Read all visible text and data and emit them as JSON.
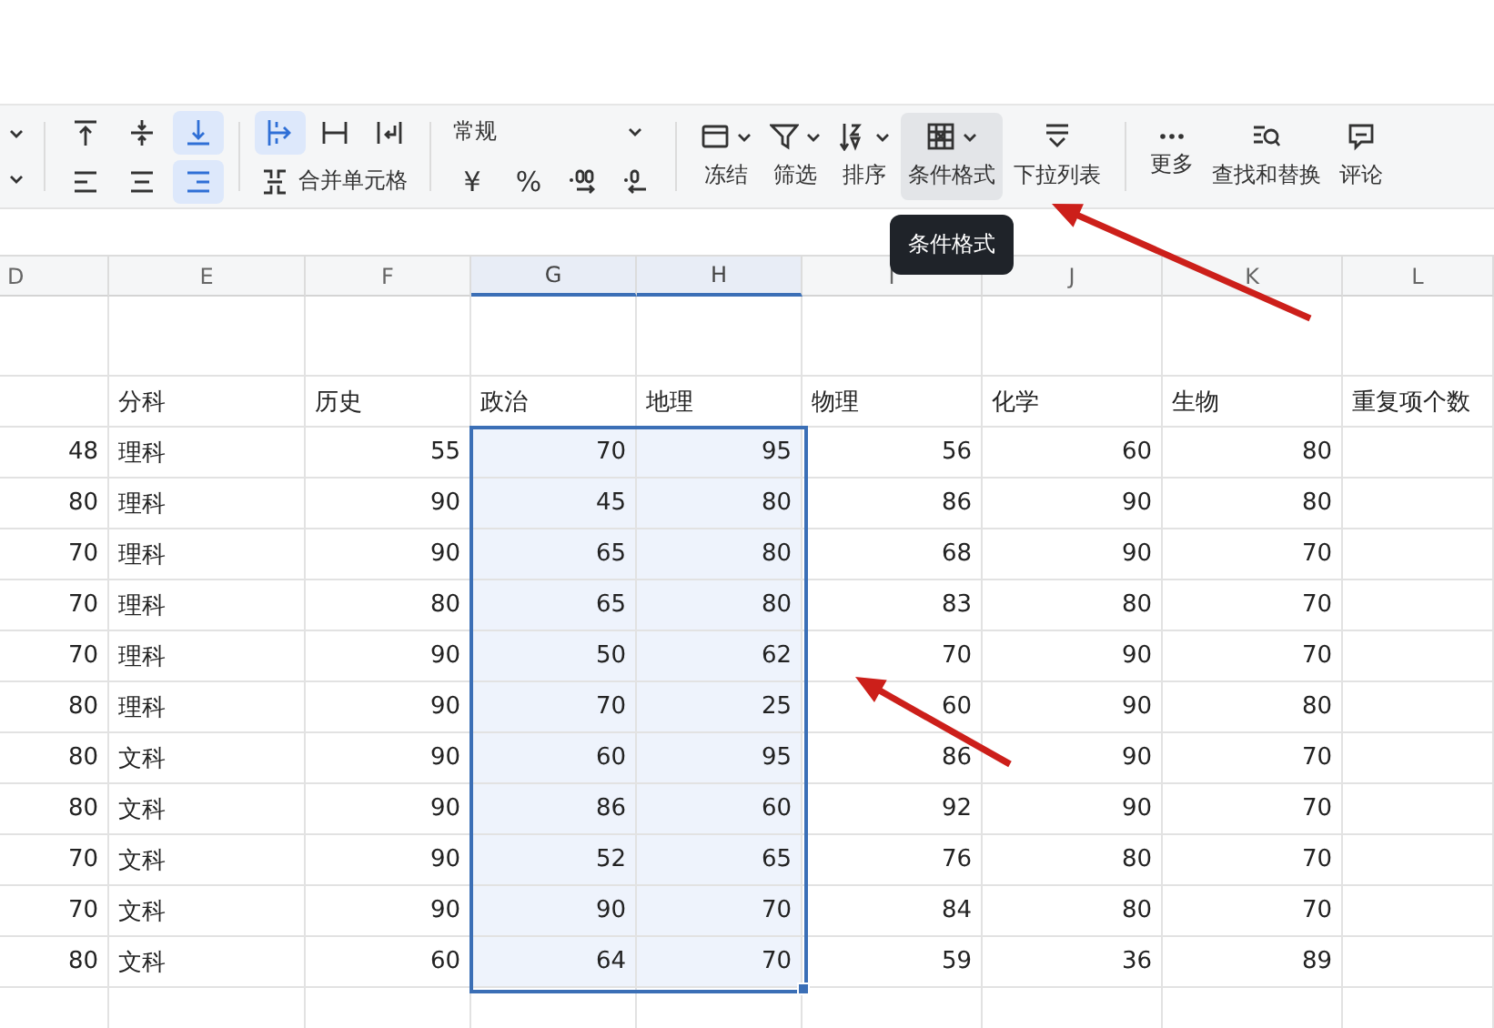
{
  "toolbar": {
    "left_dropdowns": [
      {
        "kind": "chevron"
      },
      {
        "kind": "chevron"
      }
    ],
    "align_buttons": [
      {
        "kind": "top",
        "selected": false
      },
      {
        "kind": "middle",
        "selected": false
      },
      {
        "kind": "bottom",
        "selected": true
      },
      {
        "kind": "left",
        "selected": false
      },
      {
        "kind": "center",
        "selected": false
      },
      {
        "kind": "right",
        "selected": true
      }
    ],
    "wrap_buttons": [
      {
        "kind": "overflow",
        "selected": true
      },
      {
        "kind": "clip",
        "selected": false
      },
      {
        "kind": "wrap",
        "selected": false
      }
    ],
    "merge_button": {
      "label": "合并单元格"
    },
    "number_format": {
      "value": "常规"
    },
    "number_buttons": [
      {
        "kind": "text",
        "label": "¥"
      },
      {
        "kind": "text",
        "label": "%"
      },
      {
        "kind": "increase-decimal"
      },
      {
        "kind": "decrease-decimal"
      }
    ],
    "tools": [
      {
        "kind": "freeze",
        "label": "冻结",
        "dropdown": true,
        "hovered": false
      },
      {
        "kind": "filter",
        "label": "筛选",
        "dropdown": true,
        "hovered": false
      },
      {
        "kind": "sort",
        "label": "排序",
        "dropdown": true,
        "hovered": false
      },
      {
        "kind": "conditional",
        "label": "条件格式",
        "dropdown": true,
        "hovered": true
      },
      {
        "kind": "list",
        "label": "下拉列表",
        "dropdown": false,
        "hovered": false
      },
      {
        "kind": "divider"
      },
      {
        "kind": "more",
        "label": "更多",
        "dropdown": false,
        "hovered": false
      },
      {
        "kind": "find",
        "label": "查找和替换",
        "dropdown": false,
        "hovered": false
      },
      {
        "kind": "comment",
        "label": "评论",
        "dropdown": false,
        "hovered": false
      }
    ]
  },
  "tooltip": {
    "text": "条件格式"
  },
  "sheet": {
    "columns": [
      {
        "label": "D",
        "kind": "number",
        "selected": false
      },
      {
        "label": "E",
        "kind": "text",
        "selected": false
      },
      {
        "label": "F",
        "kind": "number",
        "selected": false
      },
      {
        "label": "G",
        "kind": "number",
        "selected": true
      },
      {
        "label": "H",
        "kind": "number",
        "selected": true
      },
      {
        "label": "I",
        "kind": "number",
        "selected": false
      },
      {
        "label": "J",
        "kind": "number",
        "selected": false
      },
      {
        "label": "K",
        "kind": "number",
        "selected": false
      },
      {
        "label": "L",
        "kind": "number",
        "selected": false
      }
    ],
    "rows": [
      {
        "kind": "blank",
        "selected": false,
        "cells": [
          null,
          null,
          null,
          null,
          null,
          null,
          null,
          null,
          null
        ]
      },
      {
        "kind": "header",
        "selected": false,
        "cells": [
          null,
          "分科",
          "历史",
          "政治",
          "地理",
          "物理",
          "化学",
          "生物",
          "重复项个数"
        ]
      },
      {
        "kind": "data",
        "selected": true,
        "cells": [
          "48",
          "理科",
          "55",
          "70",
          "95",
          "56",
          "60",
          "80",
          null
        ]
      },
      {
        "kind": "data",
        "selected": true,
        "cells": [
          "80",
          "理科",
          "90",
          "45",
          "80",
          "86",
          "90",
          "80",
          null
        ]
      },
      {
        "kind": "data",
        "selected": true,
        "cells": [
          "70",
          "理科",
          "90",
          "65",
          "80",
          "68",
          "90",
          "70",
          null
        ]
      },
      {
        "kind": "data",
        "selected": true,
        "cells": [
          "70",
          "理科",
          "80",
          "65",
          "80",
          "83",
          "80",
          "70",
          null
        ]
      },
      {
        "kind": "data",
        "selected": true,
        "cells": [
          "70",
          "理科",
          "90",
          "50",
          "62",
          "70",
          "90",
          "70",
          null
        ]
      },
      {
        "kind": "data",
        "selected": true,
        "cells": [
          "80",
          "理科",
          "90",
          "70",
          "25",
          "60",
          "90",
          "80",
          null
        ]
      },
      {
        "kind": "data",
        "selected": true,
        "cells": [
          "80",
          "文科",
          "90",
          "60",
          "95",
          "86",
          "90",
          "70",
          null
        ]
      },
      {
        "kind": "data",
        "selected": true,
        "cells": [
          "80",
          "文科",
          "90",
          "86",
          "60",
          "92",
          "90",
          "70",
          null
        ]
      },
      {
        "kind": "data",
        "selected": true,
        "cells": [
          "70",
          "文科",
          "90",
          "52",
          "65",
          "76",
          "80",
          "70",
          null
        ]
      },
      {
        "kind": "data",
        "selected": true,
        "cells": [
          "70",
          "文科",
          "90",
          "90",
          "70",
          "84",
          "80",
          "70",
          null
        ]
      },
      {
        "kind": "data",
        "selected": true,
        "cells": [
          "80",
          "文科",
          "60",
          "64",
          "70",
          "59",
          "36",
          "89",
          null
        ]
      },
      {
        "kind": "blank",
        "selected": false,
        "cells": [
          null,
          null,
          null,
          null,
          null,
          null,
          null,
          null,
          null
        ]
      }
    ]
  }
}
